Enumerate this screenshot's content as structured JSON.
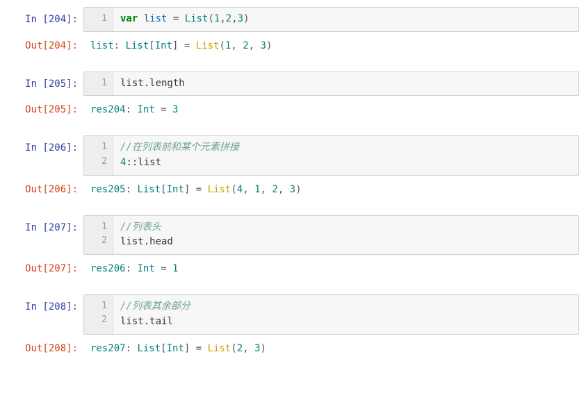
{
  "cells": [
    {
      "in_label": "In  [204]:",
      "out_label": "Out[204]:",
      "lines": [
        "1"
      ],
      "code_tokens": [
        [
          {
            "t": "var",
            "c": "kw"
          },
          {
            "t": " ",
            "c": "plain"
          },
          {
            "t": "list",
            "c": "ident"
          },
          {
            "t": " ",
            "c": "plain"
          },
          {
            "t": "=",
            "c": "punct"
          },
          {
            "t": " ",
            "c": "plain"
          },
          {
            "t": "List",
            "c": "type"
          },
          {
            "t": "(",
            "c": "punct"
          },
          {
            "t": "1",
            "c": "num"
          },
          {
            "t": ",",
            "c": "punct"
          },
          {
            "t": "2",
            "c": "num"
          },
          {
            "t": ",",
            "c": "punct"
          },
          {
            "t": "3",
            "c": "num"
          },
          {
            "t": ")",
            "c": "punct"
          }
        ]
      ],
      "output_tokens": [
        {
          "t": "list",
          "c": "res-name"
        },
        {
          "t": ": ",
          "c": "punct"
        },
        {
          "t": "List",
          "c": "res-type"
        },
        {
          "t": "[",
          "c": "punct"
        },
        {
          "t": "Int",
          "c": "res-type"
        },
        {
          "t": "]",
          "c": "punct"
        },
        {
          "t": " = ",
          "c": "punct"
        },
        {
          "t": "List",
          "c": "res-func"
        },
        {
          "t": "(",
          "c": "punct"
        },
        {
          "t": "1",
          "c": "res-num"
        },
        {
          "t": ", ",
          "c": "punct"
        },
        {
          "t": "2",
          "c": "res-num"
        },
        {
          "t": ", ",
          "c": "punct"
        },
        {
          "t": "3",
          "c": "res-num"
        },
        {
          "t": ")",
          "c": "punct"
        }
      ]
    },
    {
      "in_label": "In  [205]:",
      "out_label": "Out[205]:",
      "lines": [
        "1"
      ],
      "code_tokens": [
        [
          {
            "t": "list.length",
            "c": "plain"
          }
        ]
      ],
      "output_tokens": [
        {
          "t": "res204",
          "c": "res-name"
        },
        {
          "t": ": ",
          "c": "punct"
        },
        {
          "t": "Int",
          "c": "res-type"
        },
        {
          "t": " = ",
          "c": "punct"
        },
        {
          "t": "3",
          "c": "res-num"
        }
      ]
    },
    {
      "in_label": "In  [206]:",
      "out_label": "Out[206]:",
      "lines": [
        "1",
        "2"
      ],
      "code_tokens": [
        [
          {
            "t": "//在列表前和某个元素拼接",
            "c": "comment"
          }
        ],
        [
          {
            "t": "4",
            "c": "num"
          },
          {
            "t": "::list",
            "c": "plain"
          }
        ]
      ],
      "output_tokens": [
        {
          "t": "res205",
          "c": "res-name"
        },
        {
          "t": ": ",
          "c": "punct"
        },
        {
          "t": "List",
          "c": "res-type"
        },
        {
          "t": "[",
          "c": "punct"
        },
        {
          "t": "Int",
          "c": "res-type"
        },
        {
          "t": "]",
          "c": "punct"
        },
        {
          "t": " = ",
          "c": "punct"
        },
        {
          "t": "List",
          "c": "res-func"
        },
        {
          "t": "(",
          "c": "punct"
        },
        {
          "t": "4",
          "c": "res-num"
        },
        {
          "t": ", ",
          "c": "punct"
        },
        {
          "t": "1",
          "c": "res-num"
        },
        {
          "t": ", ",
          "c": "punct"
        },
        {
          "t": "2",
          "c": "res-num"
        },
        {
          "t": ", ",
          "c": "punct"
        },
        {
          "t": "3",
          "c": "res-num"
        },
        {
          "t": ")",
          "c": "punct"
        }
      ]
    },
    {
      "in_label": "In  [207]:",
      "out_label": "Out[207]:",
      "lines": [
        "1",
        "2"
      ],
      "code_tokens": [
        [
          {
            "t": "//列表头",
            "c": "comment"
          }
        ],
        [
          {
            "t": "list.head",
            "c": "plain"
          }
        ]
      ],
      "output_tokens": [
        {
          "t": "res206",
          "c": "res-name"
        },
        {
          "t": ": ",
          "c": "punct"
        },
        {
          "t": "Int",
          "c": "res-type"
        },
        {
          "t": " = ",
          "c": "punct"
        },
        {
          "t": "1",
          "c": "res-num"
        }
      ]
    },
    {
      "in_label": "In  [208]:",
      "out_label": "Out[208]:",
      "lines": [
        "1",
        "2"
      ],
      "code_tokens": [
        [
          {
            "t": "//列表其余部分",
            "c": "comment"
          }
        ],
        [
          {
            "t": "list.tail",
            "c": "plain"
          }
        ]
      ],
      "output_tokens": [
        {
          "t": "res207",
          "c": "res-name"
        },
        {
          "t": ": ",
          "c": "punct"
        },
        {
          "t": "List",
          "c": "res-type"
        },
        {
          "t": "[",
          "c": "punct"
        },
        {
          "t": "Int",
          "c": "res-type"
        },
        {
          "t": "]",
          "c": "punct"
        },
        {
          "t": " = ",
          "c": "punct"
        },
        {
          "t": "List",
          "c": "res-func"
        },
        {
          "t": "(",
          "c": "punct"
        },
        {
          "t": "2",
          "c": "res-num"
        },
        {
          "t": ", ",
          "c": "punct"
        },
        {
          "t": "3",
          "c": "res-num"
        },
        {
          "t": ")",
          "c": "punct"
        }
      ]
    }
  ]
}
